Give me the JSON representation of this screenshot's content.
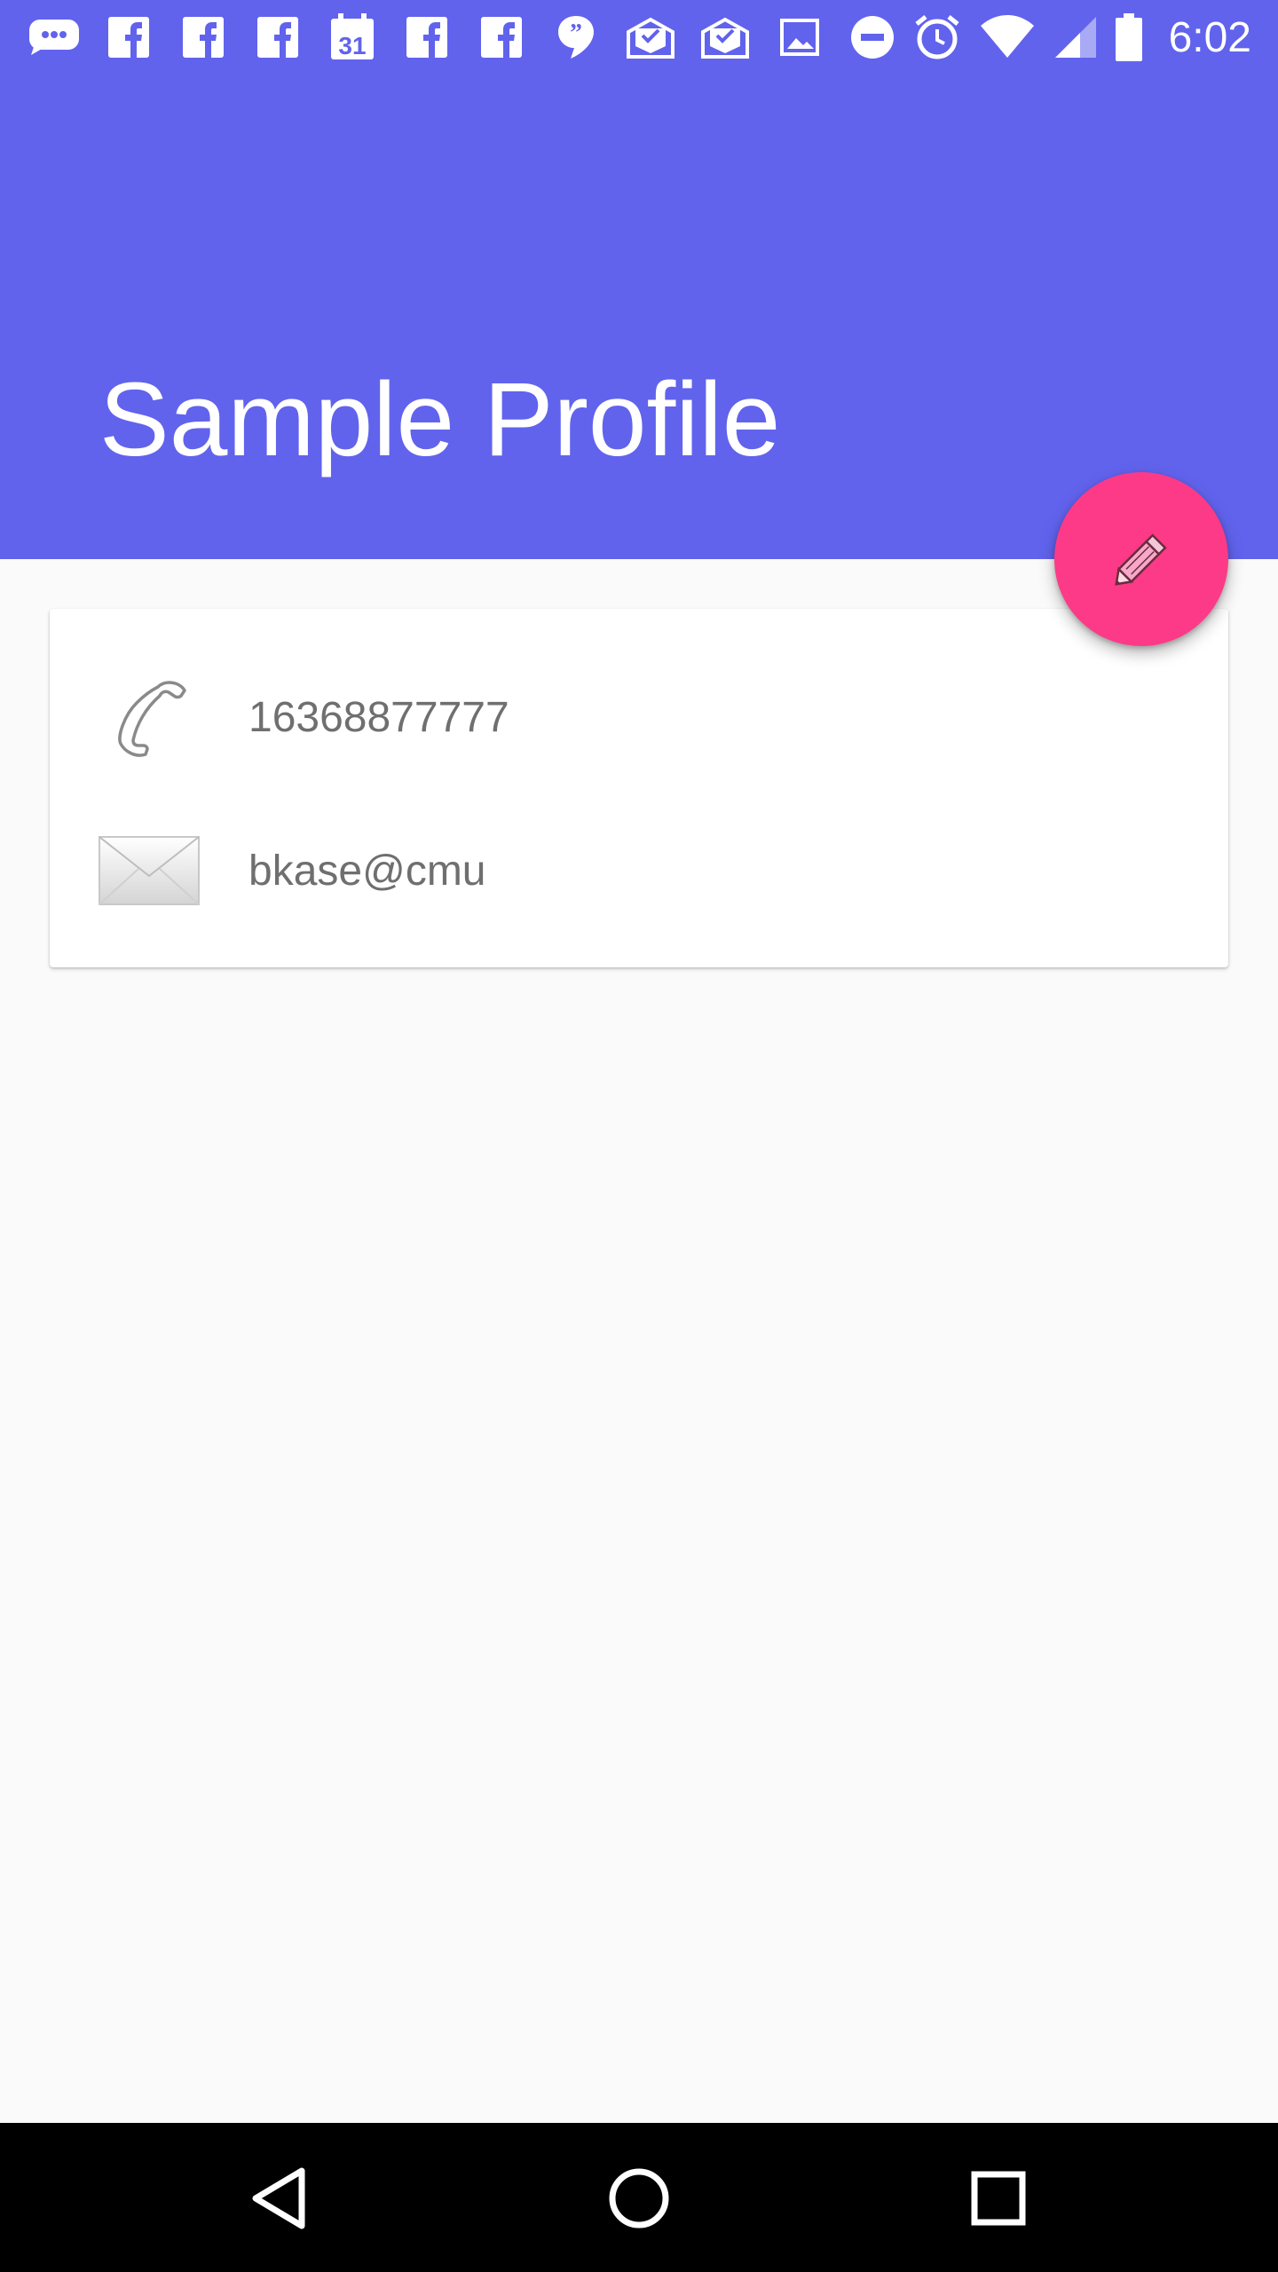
{
  "status_bar": {
    "time": "6:02",
    "notification_icons": [
      "messages-icon",
      "facebook-icon",
      "facebook-icon",
      "facebook-icon",
      "calendar-icon",
      "facebook-icon",
      "facebook-icon",
      "quote-icon",
      "mail-icon",
      "mail-icon",
      "image-icon"
    ],
    "calendar_day": "31",
    "system_icons": [
      "do-not-disturb-icon",
      "alarm-icon",
      "wifi-icon",
      "cell-signal-icon",
      "battery-icon"
    ]
  },
  "app_bar": {
    "title": "Sample Profile",
    "background_color": "#6163ed"
  },
  "fab": {
    "icon": "pencil-icon",
    "color": "#fd3a87"
  },
  "card": {
    "rows": [
      {
        "icon": "phone-icon",
        "text": "16368877777"
      },
      {
        "icon": "envelope-icon",
        "text": "bkase@cmu"
      }
    ]
  },
  "nav_bar": {
    "buttons": [
      "back-icon",
      "home-icon",
      "recents-icon"
    ]
  }
}
